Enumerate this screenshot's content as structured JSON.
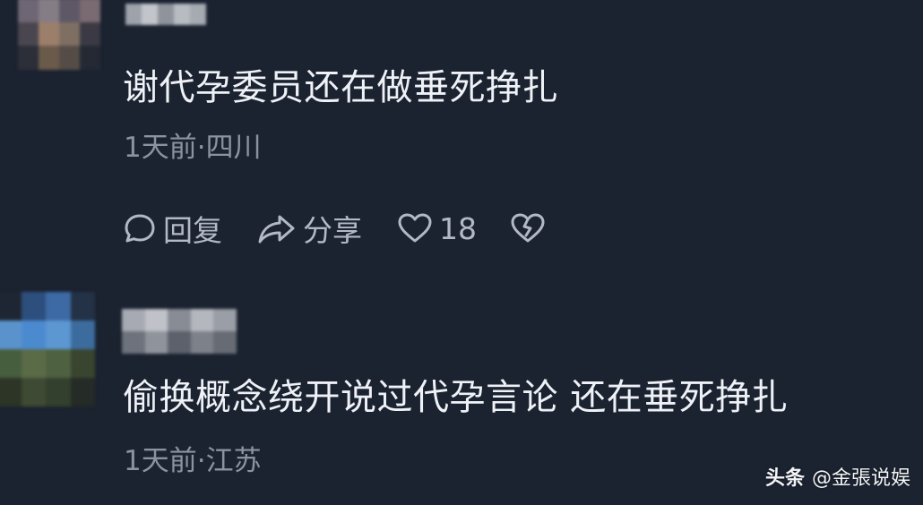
{
  "comments": [
    {
      "text": "谢代孕委员还在做垂死挣扎",
      "meta": "1天前·四川",
      "actions": {
        "reply_label": "回复",
        "share_label": "分享",
        "like_count": "18"
      }
    },
    {
      "text": "偷换概念绕开说过代孕言论 还在垂死挣扎",
      "meta": "1天前·江苏"
    }
  ],
  "watermark": {
    "brand": "头条",
    "author": "@金張说娱"
  },
  "icons": {
    "reply": "comment-bubble-icon",
    "share": "share-arrow-icon",
    "like": "heart-icon",
    "dislike": "broken-heart-icon"
  },
  "colors": {
    "background": "#1b2230",
    "text": "#eef1f6",
    "meta": "#8c93a0",
    "action": "#b3b9c4"
  }
}
